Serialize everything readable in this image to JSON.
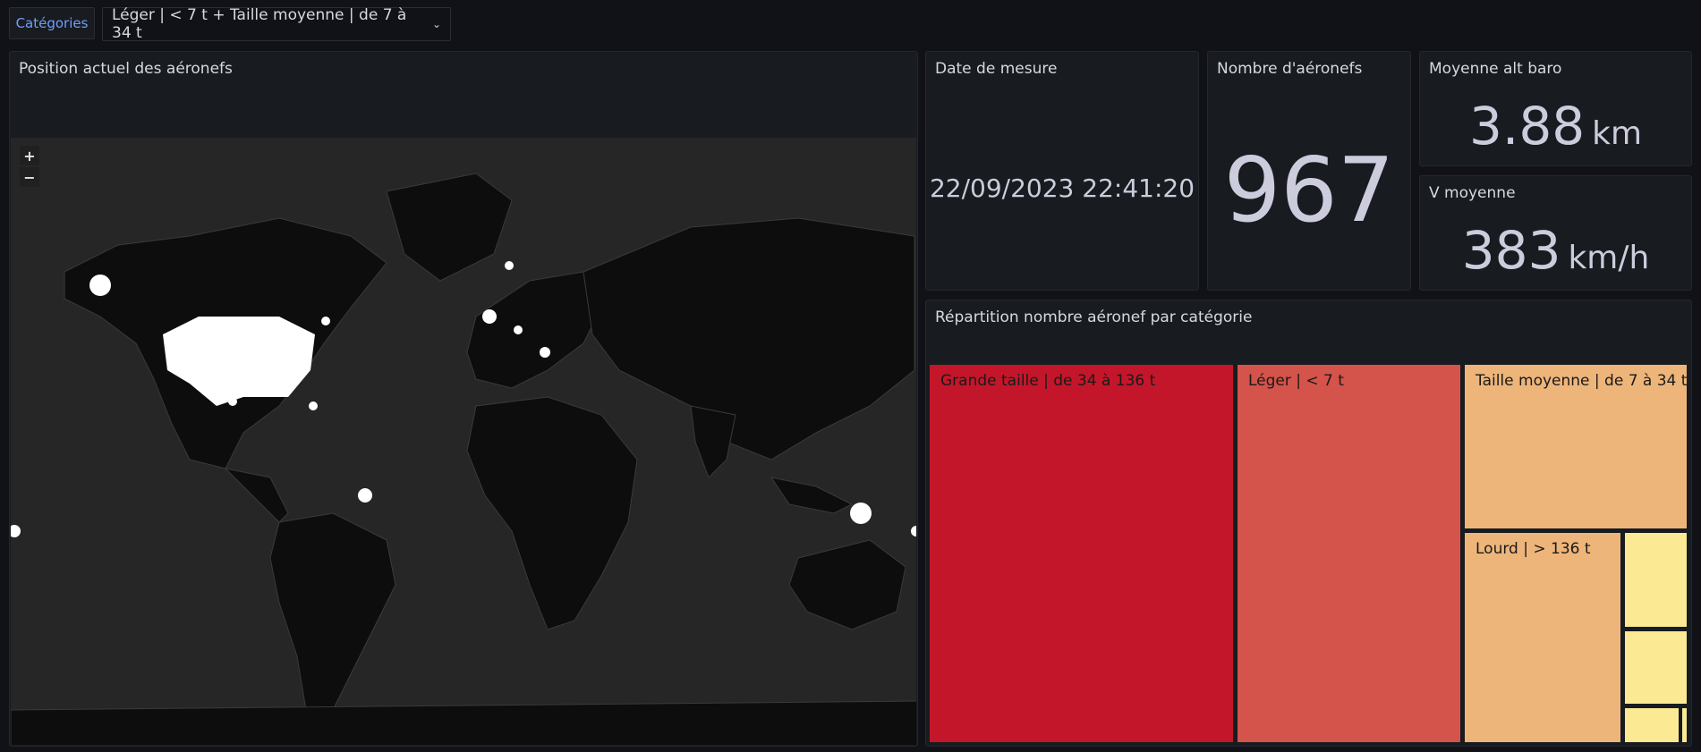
{
  "variables": {
    "label": "Catégories",
    "selected": "Léger | < 7 t + Taille moyenne | de 7 à 34 t"
  },
  "panels": {
    "map": {
      "title": "Position actuel des aéronefs",
      "zoom_in": "+",
      "zoom_out": "−"
    },
    "date": {
      "title": "Date de mesure",
      "value": "22/09/2023 22:41:20"
    },
    "count": {
      "title": "Nombre d'aéronefs",
      "value": "967"
    },
    "alt": {
      "title": "Moyenne alt baro",
      "value": "3.88",
      "unit": "km"
    },
    "speed": {
      "title": "V moyenne",
      "value": "383",
      "unit": "km/h"
    },
    "treemap": {
      "title": "Répartition nombre aéronef par catégorie",
      "tiles": [
        {
          "label": "Grande taille | de 34 à 136 t",
          "color": "#c4162a"
        },
        {
          "label": "Léger | < 7 t",
          "color": "#d4534a"
        },
        {
          "label": "Taille moyenne | de 7 à 34 t",
          "color": "#eeb57a"
        },
        {
          "label": "Lourd | > 136 t",
          "color": "#eeb57a"
        },
        {
          "label": "",
          "color": "#fbea93"
        },
        {
          "label": "",
          "color": "#fbea93"
        },
        {
          "label": "",
          "color": "#fbea93"
        },
        {
          "label": "",
          "color": "#fbea93"
        }
      ]
    }
  },
  "colors": {
    "background": "#111217",
    "panel": "#181b1f",
    "accent": "#6e9fff",
    "map_land": "#0d0d0d",
    "map_water": "#262626"
  }
}
